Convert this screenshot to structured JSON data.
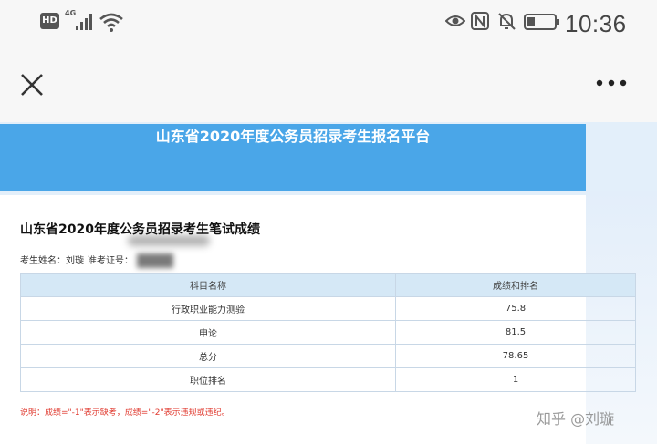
{
  "status_bar": {
    "hd": "HD",
    "network": "4G",
    "time": "10:36"
  },
  "page": {
    "banner_title": "山东省2020年度公务员招录考生报名平台",
    "heading": "山东省2020年度公务员招录考生笔试成绩",
    "candidate_name_label": "考生姓名：刘璇",
    "ticket_label": "准考证号："
  },
  "table": {
    "headers": [
      "科目名称",
      "成绩和排名"
    ],
    "rows": [
      [
        "行政职业能力测验",
        "75.8"
      ],
      [
        "申论",
        "81.5"
      ],
      [
        "总分",
        "78.65"
      ],
      [
        "职位排名",
        "1"
      ]
    ]
  },
  "note": "说明：成绩=\"-1\"表示缺考，成绩=\"-2\"表示违规或违纪。",
  "watermark": "知乎 @刘璇",
  "colors": {
    "banner": "#4aa6e8",
    "table_header": "#d5e8f6",
    "note_red": "#e03a2f"
  }
}
